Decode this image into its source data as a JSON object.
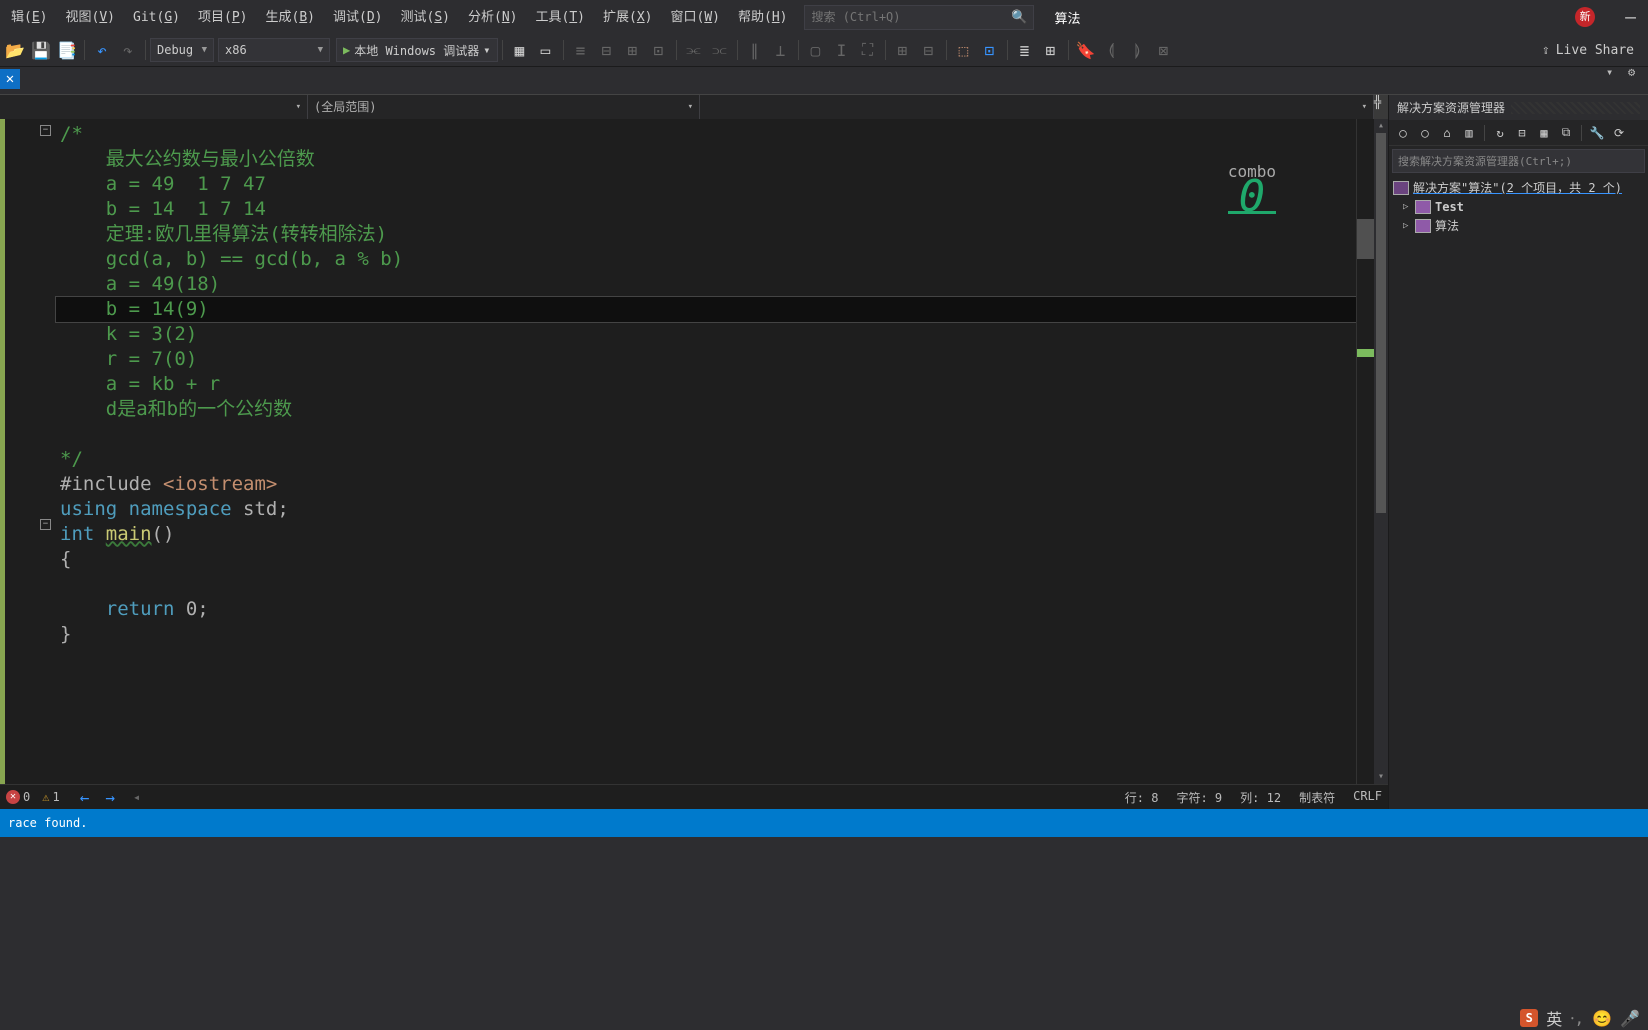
{
  "menu": {
    "items": [
      {
        "label": "辑",
        "accel": "E"
      },
      {
        "label": "视图",
        "accel": "V"
      },
      {
        "label": "Git",
        "accel": "G"
      },
      {
        "label": "项目",
        "accel": "P"
      },
      {
        "label": "生成",
        "accel": "B"
      },
      {
        "label": "调试",
        "accel": "D"
      },
      {
        "label": "测试",
        "accel": "S"
      },
      {
        "label": "分析",
        "accel": "N"
      },
      {
        "label": "工具",
        "accel": "T"
      },
      {
        "label": "扩展",
        "accel": "X"
      },
      {
        "label": "窗口",
        "accel": "W"
      },
      {
        "label": "帮助",
        "accel": "H"
      }
    ],
    "search_placeholder": "搜索 (Ctrl+Q)",
    "solution": "算法",
    "new_badge": "新"
  },
  "toolbar": {
    "config": "Debug",
    "platform": "x86",
    "run": "本地 Windows 调试器",
    "liveshare": "Live Share"
  },
  "nav": {
    "scope": "(全局范围)"
  },
  "code_lines": [
    {
      "cls": "comment",
      "txt": "/*",
      "fold": true
    },
    {
      "cls": "comment",
      "txt": "    最大公约数与最小公倍数"
    },
    {
      "cls": "comment",
      "txt": "    a = 49  1 7 47"
    },
    {
      "cls": "comment",
      "txt": "    b = 14  1 7 14"
    },
    {
      "cls": "comment",
      "txt": "    定理:欧几里得算法(转转相除法)"
    },
    {
      "cls": "comment",
      "txt": "    gcd(a, b) == gcd(b, a % b)"
    },
    {
      "cls": "comment",
      "txt": "    a = 49(18)"
    },
    {
      "cls": "comment",
      "txt": "    b = 14(9)",
      "current": true
    },
    {
      "cls": "comment",
      "txt": "    k = 3(2)"
    },
    {
      "cls": "comment",
      "txt": "    r = 7(0)"
    },
    {
      "cls": "comment",
      "txt": "    a = kb + r"
    },
    {
      "cls": "comment",
      "txt": "    d是a和b的一个公约数"
    },
    {
      "cls": "comment",
      "txt": ""
    },
    {
      "cls": "comment",
      "txt": "*/"
    }
  ],
  "code_cpp": {
    "include_kw": "#include ",
    "include_hdr": "<iostream>",
    "using": "using ",
    "namespace": "namespace ",
    "std": "std",
    "int": "int ",
    "main": "main",
    "paren": "()",
    "brace_o": "{",
    "return": "    return ",
    "zero": "0",
    "semi": ";",
    "brace_c": "}"
  },
  "combo": {
    "label": "combo",
    "value": "0"
  },
  "solution_explorer": {
    "title": "解决方案资源管理器",
    "search_placeholder": "搜索解决方案资源管理器(Ctrl+;)",
    "root": "解决方案\"算法\"(2 个项目，共 2 个)",
    "projects": [
      "Test",
      "算法"
    ]
  },
  "status": {
    "errors": "0",
    "warnings": "1",
    "line": "行: 8",
    "char": "字符: 9",
    "col": "列: 12",
    "tabs": "制表符",
    "crlf": "CRLF"
  },
  "output": {
    "msg": "race found."
  },
  "ime": {
    "lang": "英"
  }
}
